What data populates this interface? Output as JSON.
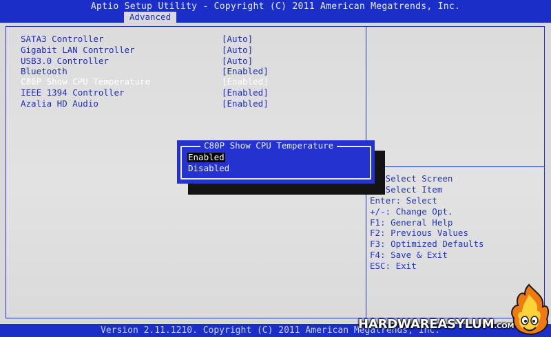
{
  "header": {
    "title": "Aptio Setup Utility - Copyright (C) 2011 American Megatrends, Inc.",
    "active_tab": "Advanced"
  },
  "settings": [
    {
      "label": "SATA3 Controller",
      "value": "[Auto]",
      "active": false
    },
    {
      "label": "Gigabit LAN Controller",
      "value": "[Auto]",
      "active": false
    },
    {
      "label": "USB3.0 Controller",
      "value": "[Auto]",
      "active": false
    },
    {
      "label": "Bluetooth",
      "value": "[Enabled]",
      "active": false
    },
    {
      "label": "C80P Show CPU Temperature",
      "value": "[Enabled]",
      "active": true
    },
    {
      "label": "IEEE 1394 Controller",
      "value": "[Enabled]",
      "active": false
    },
    {
      "label": "Azalia HD Audio",
      "value": "[Enabled]",
      "active": false
    }
  ],
  "help": [
    "   Select Screen",
    "   Select Item",
    "Enter: Select",
    "+/-: Change Opt.",
    "F1: General Help",
    "F2: Previous Values",
    "F3: Optimized Defaults",
    "F4: Save & Exit",
    "ESC: Exit"
  ],
  "popup": {
    "title": "C80P Show CPU Temperature",
    "options": [
      {
        "label": "Enabled",
        "selected": true
      },
      {
        "label": "Disabled",
        "selected": false
      }
    ]
  },
  "footer": {
    "text": "Version 2.11.1210. Copyright (C) 2011 American Megatrends, Inc."
  },
  "watermark": {
    "text": "HARDWAREASYLUM",
    "suffix": ".COM"
  },
  "colors": {
    "bar_blue": "#1b2fc8",
    "text_blue": "#1f2fb0",
    "background": "#d9d9d9"
  }
}
